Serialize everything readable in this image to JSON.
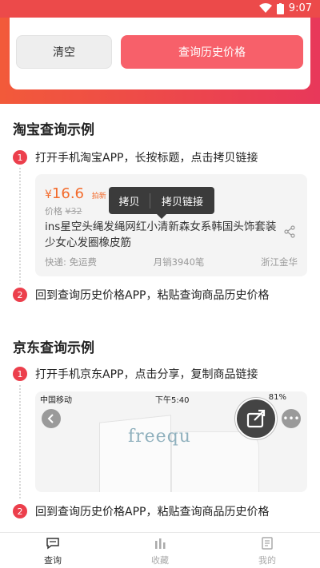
{
  "status_bar": {
    "time": "9:07"
  },
  "buttons": {
    "clear": "清空",
    "query": "查询历史价格"
  },
  "taobao": {
    "section_title": "淘宝查询示例",
    "step1": {
      "num": "1",
      "text": "打开手机淘宝APP，长按标题，点击拷贝链接"
    },
    "step2": {
      "num": "2",
      "text": "回到查询历史价格APP，粘贴查询商品历史价格"
    },
    "card": {
      "price_symbol": "¥",
      "price": "16.6",
      "badge": "拍新",
      "old_price_label": "价格",
      "old_price": "¥32",
      "title": "ins星空头绳发绳网红小清新森女系韩国头饰套装少女心发圈橡皮筋",
      "shipping": "快递: 免运费",
      "sales": "月销3940笔",
      "location": "浙江金华"
    },
    "popup": {
      "copy": "拷贝",
      "copy_link": "拷贝链接"
    }
  },
  "jd": {
    "section_title": "京东查询示例",
    "step1": {
      "num": "1",
      "text": "打开手机京东APP，点击分享，复制商品链接"
    },
    "step2": {
      "num": "2",
      "text": "回到查询历史价格APP，粘贴查询商品历史价格"
    },
    "card": {
      "carrier": "中国移动",
      "time": "下午5:40",
      "battery": "81%",
      "product_text": "freequ"
    }
  },
  "tabs": [
    {
      "label": "查询",
      "icon": "chat-bubble-icon",
      "active": true
    },
    {
      "label": "收藏",
      "icon": "bar-chart-icon",
      "active": false
    },
    {
      "label": "我的",
      "icon": "profile-card-icon",
      "active": false
    }
  ],
  "colors": {
    "accent": "#ec4a4a",
    "query_button": "#f7606a",
    "price": "#f36b2c"
  }
}
